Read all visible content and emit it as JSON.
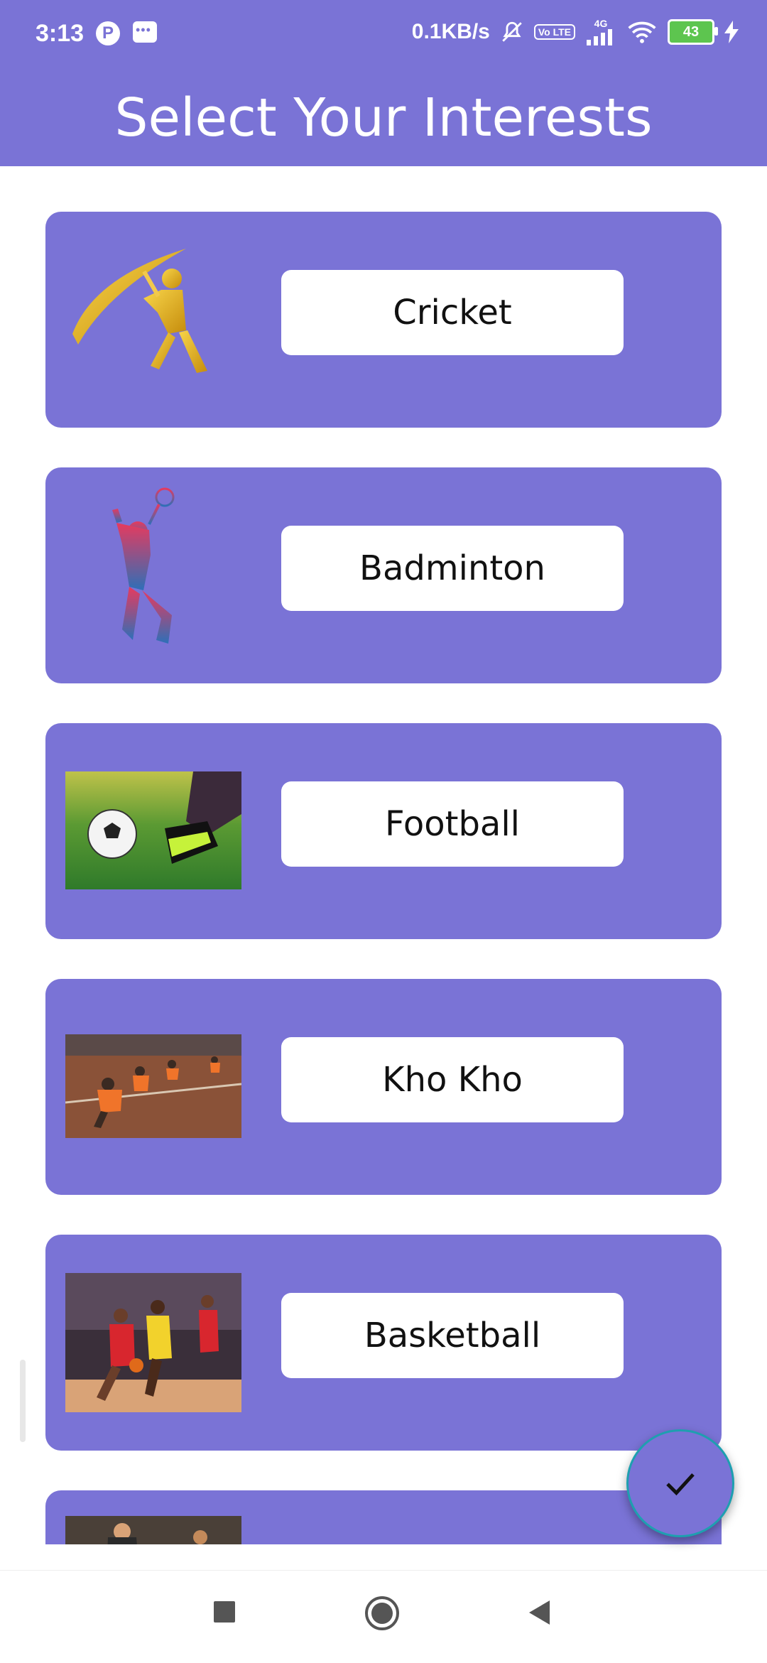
{
  "status_bar": {
    "time": "3:13",
    "network_speed": "0.1KB/s",
    "volte_label": "Vo LTE",
    "network_type": "4G",
    "battery_level": "43"
  },
  "app_bar": {
    "title": "Select Your Interests"
  },
  "interests": [
    {
      "label": "Cricket",
      "icon": "cricket-player-icon"
    },
    {
      "label": "Badminton",
      "icon": "badminton-player-icon"
    },
    {
      "label": "Football",
      "icon": "football-photo"
    },
    {
      "label": "Kho Kho",
      "icon": "kho-kho-photo"
    },
    {
      "label": "Basketball",
      "icon": "basketball-photo"
    },
    {
      "label": "",
      "icon": "partial-sport-photo"
    }
  ],
  "fab": {
    "icon": "check-icon"
  },
  "nav_bar": {
    "recent": "square-icon",
    "home": "circle-home-icon",
    "back": "triangle-back-icon"
  },
  "colors": {
    "primary": "#7a73d6",
    "card_label_bg": "#ffffff",
    "text_dark": "#111111"
  }
}
